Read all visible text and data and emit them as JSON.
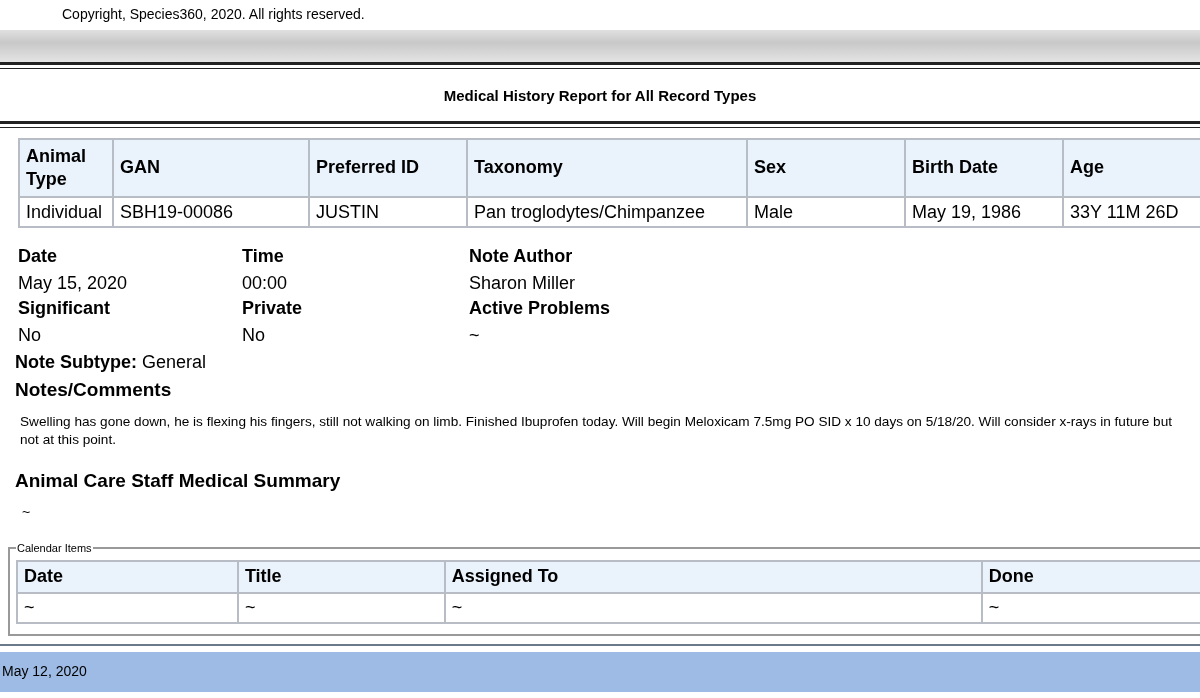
{
  "previous_page": {
    "copyright": "Copyright, Species360, 2020. All rights reserved."
  },
  "report": {
    "title": "Medical History Report for All Record Types"
  },
  "animal_table": {
    "columns": [
      "Animal Type",
      "GAN",
      "Preferred ID",
      "Taxonomy",
      "Sex",
      "Birth Date",
      "Age"
    ],
    "rows": [
      [
        "Individual",
        "SBH19-00086",
        "JUSTIN",
        "Pan troglodytes/Chimpanzee",
        "Male",
        "May 19, 1986",
        "33Y 11M 26D"
      ]
    ]
  },
  "fields": [
    {
      "label": "Date",
      "value": "May 15, 2020"
    },
    {
      "label": "Time",
      "value": "00:00"
    },
    {
      "label": "Note Author",
      "value": "Sharon Miller"
    },
    {
      "label": "Significant",
      "value": "No"
    },
    {
      "label": "Private",
      "value": "No"
    },
    {
      "label": "Active Problems",
      "value": "~"
    }
  ],
  "note_subtype": {
    "label": "Note Subtype:",
    "value": "General"
  },
  "notes": {
    "heading": "Notes/Comments",
    "text": "Swelling has gone down, he is flexing his fingers, still not walking on limb. Finished Ibuprofen today. Will begin Meloxicam 7.5mg PO SID x 10 days on 5/18/20. Will consider x-rays in future but not at this point."
  },
  "summary": {
    "heading": "Animal Care Staff Medical Summary",
    "text": "~"
  },
  "calendar": {
    "legend": "Calendar Items",
    "columns": [
      "Date",
      "Title",
      "Assigned To",
      "Done"
    ],
    "rows": [
      [
        "~",
        "~",
        "~",
        "~"
      ]
    ]
  },
  "next_record": {
    "date": "May 12, 2020"
  }
}
